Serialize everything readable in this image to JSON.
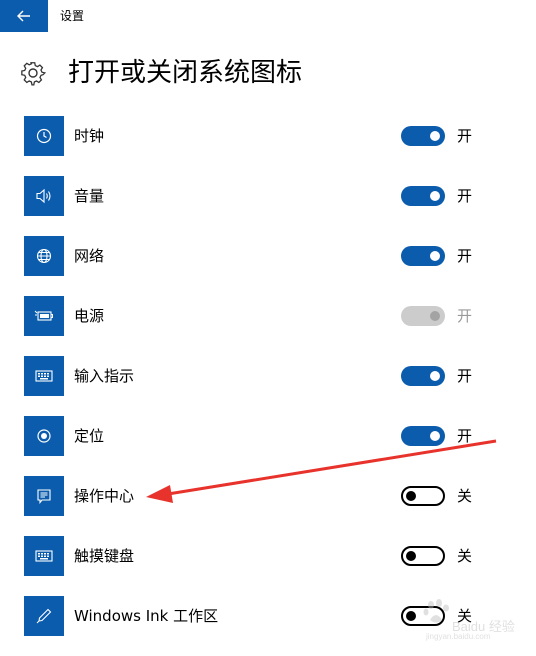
{
  "window": {
    "app_title": "设置",
    "back_icon": "arrow-left-icon"
  },
  "header": {
    "icon": "gear-icon",
    "title": "打开或关闭系统图标"
  },
  "colors": {
    "accent": "#0b5cad",
    "annotation": "#e8332c"
  },
  "items": [
    {
      "label": "时钟",
      "icon": "clock-icon",
      "state": "on",
      "state_label": "开"
    },
    {
      "label": "音量",
      "icon": "speaker-icon",
      "state": "on",
      "state_label": "开"
    },
    {
      "label": "网络",
      "icon": "globe-icon",
      "state": "on",
      "state_label": "开"
    },
    {
      "label": "电源",
      "icon": "battery-plug-icon",
      "state": "disabled",
      "state_label": "开"
    },
    {
      "label": "输入指示",
      "icon": "keyboard-icon",
      "state": "on",
      "state_label": "开"
    },
    {
      "label": "定位",
      "icon": "location-target-icon",
      "state": "on",
      "state_label": "开"
    },
    {
      "label": "操作中心",
      "icon": "action-center-icon",
      "state": "off",
      "state_label": "关"
    },
    {
      "label": "触摸键盘",
      "icon": "keyboard-icon",
      "state": "off",
      "state_label": "关"
    },
    {
      "label": "Windows Ink 工作区",
      "icon": "pen-icon",
      "state": "off",
      "state_label": "关"
    }
  ],
  "watermark": {
    "text": "Baidu 经验",
    "sub": "jingyan.baidu.com"
  }
}
